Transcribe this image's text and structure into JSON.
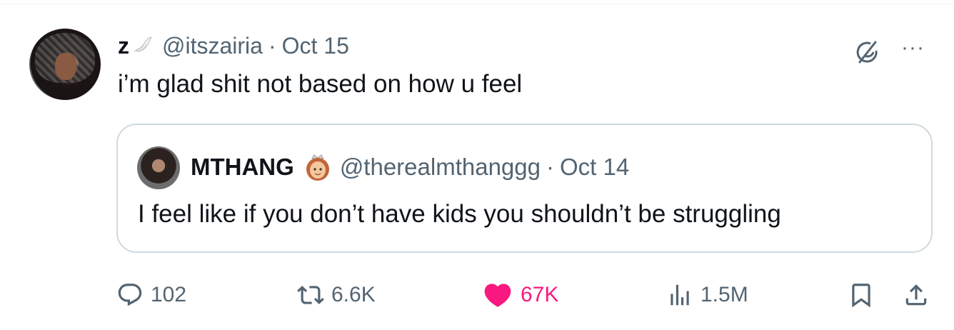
{
  "tweet": {
    "display_name": "z",
    "handle": "@itszairia",
    "separator": "·",
    "date": "Oct 15",
    "text": "i’m glad shit not based on how u feel",
    "more_label": "···"
  },
  "quoted": {
    "display_name": "MTHANG",
    "handle": "@therealmthanggg",
    "separator": "·",
    "date": "Oct 14",
    "text": "I feel like if you don’t have kids you shouldn’t be struggling"
  },
  "actions": {
    "replies": "102",
    "reposts": "6.6K",
    "likes": "67K",
    "views": "1.5M"
  },
  "colors": {
    "like": "#f91880",
    "muted": "#536471",
    "border": "#cfd9de"
  },
  "icons": {
    "reply": "reply-icon",
    "repost": "repost-icon",
    "like": "heart-icon",
    "views": "views-icon",
    "bookmark": "bookmark-icon",
    "share": "share-icon",
    "grok": "grok-icon",
    "more": "more-icon"
  }
}
